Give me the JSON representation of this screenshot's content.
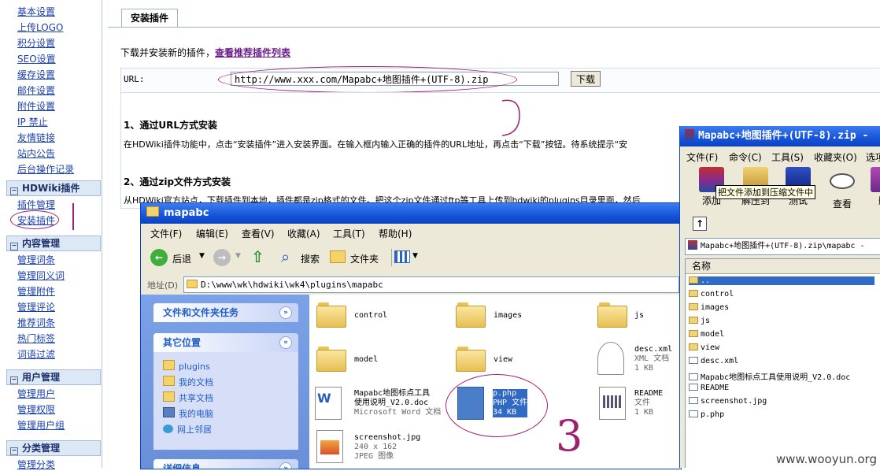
{
  "nav": {
    "sys_items": [
      "基本设置",
      "上传LOGO",
      "积分设置",
      "SEO设置",
      "缓存设置",
      "邮件设置",
      "附件设置",
      "IP 禁止",
      "友情链接",
      "站内公告",
      "后台操作记录"
    ],
    "hdwiki_header": "HDWiki插件",
    "hdwiki_items": [
      "插件管理",
      "安装插件"
    ],
    "content_header": "内容管理",
    "content_items": [
      "管理词条",
      "管理同义词",
      "管理附件",
      "管理评论",
      "推荐词条",
      "热门标签",
      "词语过滤"
    ],
    "user_header": "用户管理",
    "user_items": [
      "管理用户",
      "管理权限",
      "管理用户组"
    ],
    "cat_header": "分类管理",
    "cat_items": [
      "管理分类"
    ]
  },
  "main": {
    "tab_label": "安装插件",
    "desc_text": "下载并安装新的插件，",
    "desc_link": "查看推荐插件列表",
    "url_label": "URL:",
    "url_value": "http://www.xxx.com/Mapabc+地图插件+(UTF-8).zip",
    "download_button": "下载",
    "section1_title": "1、通过URL方式安装",
    "section1_text": "在HDWiki插件功能中，点击“安装插件”进入安装界面。在输入框内输入正确的插件的URL地址，再点击“下载”按钮。待系统提示“安",
    "section2_title": "2、通过zip文件方式安装",
    "section2_text": "从HDWiki官方站点，下载插件到本地，插件都是zip格式的文件。把这个zip文件通过ftp等工具上传到hdwiki的plugins目录里面，然后"
  },
  "explorer": {
    "title": "mapabc",
    "menu": [
      "文件(F)",
      "编辑(E)",
      "查看(V)",
      "收藏(A)",
      "工具(T)",
      "帮助(H)"
    ],
    "back_label": "后退",
    "search_label": "搜索",
    "folders_label": "文件夹",
    "address_label": "地址(D)",
    "address_value": "D:\\www\\wk\\hdwiki\\wk4\\plugins\\mapabc",
    "tasks_header": "文件和文件夹任务",
    "other_header": "其它位置",
    "other_links": [
      "plugins",
      "我的文档",
      "共享文档",
      "我的电脑",
      "网上邻居"
    ],
    "details_header": "详细信息",
    "files": {
      "control": "control",
      "images": "images",
      "js": "js",
      "model": "model",
      "view": "view",
      "desc_name": "desc.xml",
      "desc_type": "XML 文档",
      "desc_size": "1 KB",
      "doc_name1": "Mapabc地图标点工具",
      "doc_name2": "使用说明_V2.0.doc",
      "doc_type": "Microsoft Word 文档",
      "php_name": "p.php",
      "php_type": "PHP 文件",
      "php_size": "34 KB",
      "readme_name": "README",
      "readme_type": "文件",
      "readme_size": "1 KB",
      "shot_name": "screenshot.jpg",
      "shot_dims": "240 x 162",
      "shot_type": "JPEG 图像"
    }
  },
  "rar": {
    "title": "Mapabc+地图插件+(UTF-8).zip -",
    "menu": [
      "文件(F)",
      "命令(C)",
      "工具(S)",
      "收藏夹(O)",
      "选项"
    ],
    "buttons": [
      "添加",
      "解压到",
      "测试",
      "查看",
      "删"
    ],
    "tooltip": "把文件添加到压缩文件中",
    "path": "Mapabc+地图插件+(UTF-8).zip\\mapabc -",
    "col_name": "名称",
    "items": [
      "..",
      "control",
      "images",
      "js",
      "model",
      "view",
      "desc.xml",
      "Mapabc地图标点工具使用说明_V2.0.doc",
      "README",
      "screenshot.jpg",
      "p.php"
    ]
  },
  "annotation_number": "3",
  "watermark": "www.wooyun.org",
  "colors": {
    "accent": "#1654d8",
    "link": "#1a3fb0",
    "annotation": "#a02070"
  }
}
